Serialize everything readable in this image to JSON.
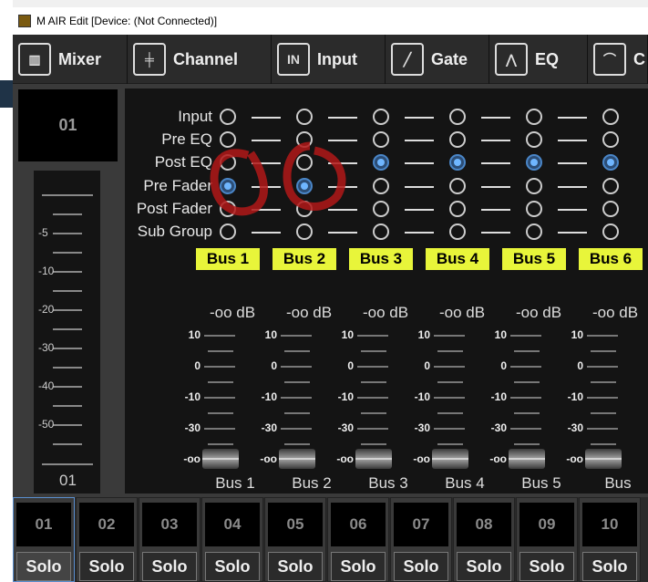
{
  "window": {
    "title": "M AIR Edit [Device: (Not Connected)]"
  },
  "toolbar": {
    "tabs": [
      {
        "label": "Mixer",
        "icon": "mixer-icon",
        "glyph": "▥"
      },
      {
        "label": "Channel",
        "icon": "channel-icon",
        "glyph": "╪"
      },
      {
        "label": "Input",
        "icon": "input-icon",
        "glyph": "IN"
      },
      {
        "label": "Gate",
        "icon": "gate-icon",
        "glyph": "╱"
      },
      {
        "label": "EQ",
        "icon": "eq-icon",
        "glyph": "⋀"
      },
      {
        "label": "C",
        "icon": "compressor-icon",
        "glyph": "⌒"
      }
    ]
  },
  "left": {
    "channel": "01",
    "fader_label": "01",
    "scale": [
      "-5",
      "-10",
      "-20",
      "-30",
      "-40",
      "-50"
    ]
  },
  "sends": {
    "tap_labels": [
      "Input",
      "Pre EQ",
      "Post EQ",
      "Pre Fader",
      "Post Fader",
      "Sub Group"
    ],
    "buses": [
      {
        "label": "Bus 1",
        "selected": "Pre Fader",
        "level": "-oo dB",
        "name": "Bus 1"
      },
      {
        "label": "Bus 2",
        "selected": "Pre Fader",
        "level": "-oo dB",
        "name": "Bus 2"
      },
      {
        "label": "Bus 3",
        "selected": "Post EQ",
        "level": "-oo dB",
        "name": "Bus 3"
      },
      {
        "label": "Bus 4",
        "selected": "Post EQ",
        "level": "-oo dB",
        "name": "Bus 4"
      },
      {
        "label": "Bus 5",
        "selected": "Post EQ",
        "level": "-oo dB",
        "name": "Bus 5"
      },
      {
        "label": "Bus 6",
        "selected": "Post EQ",
        "level": "-oo dB",
        "name": "Bus"
      }
    ],
    "scale": [
      "10",
      "0",
      "-10",
      "-30",
      "-oo"
    ]
  },
  "channels": {
    "selected": "01",
    "solo_label": "Solo",
    "numbers": [
      "01",
      "02",
      "03",
      "04",
      "05",
      "06",
      "07",
      "08",
      "09",
      "10"
    ]
  },
  "colors": {
    "bus_label": "#e8f53a",
    "selected_radio": "#6fb6ff",
    "annotation": "#b01818"
  }
}
